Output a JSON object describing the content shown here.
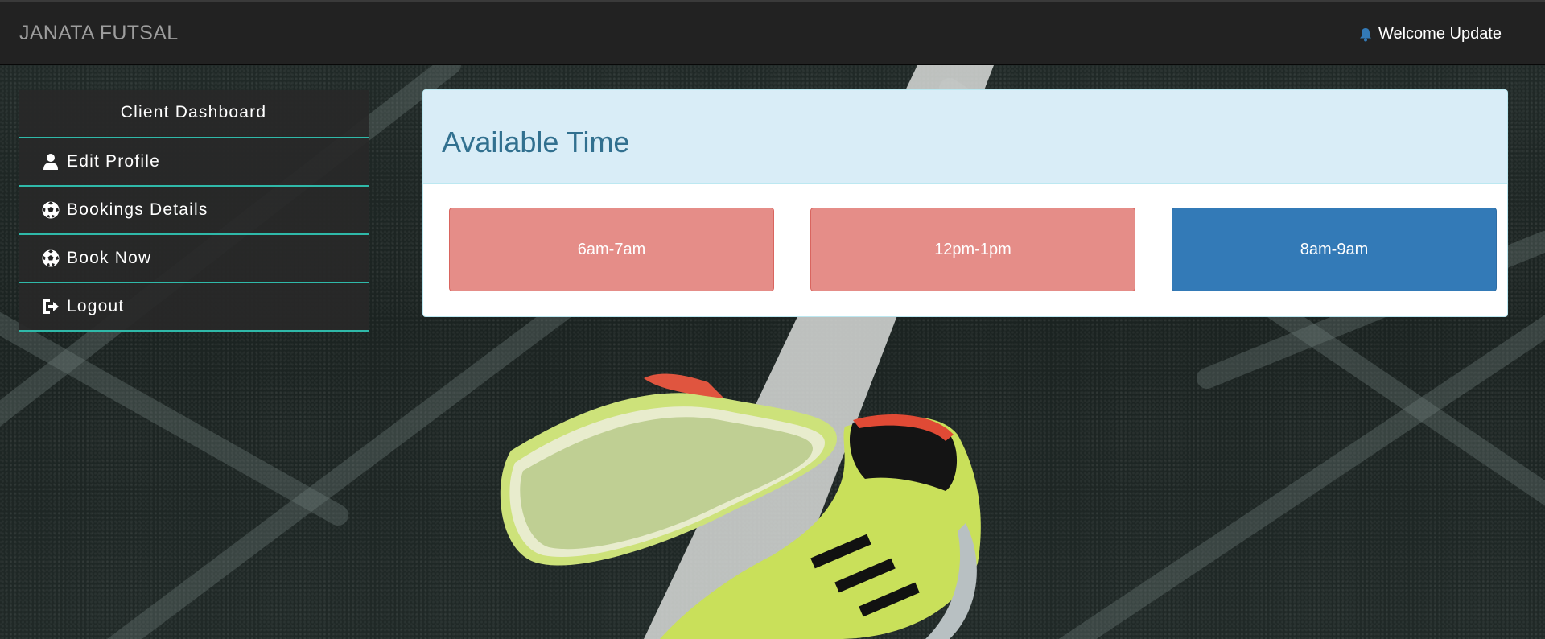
{
  "navbar": {
    "brand": "JANATA FUTSAL",
    "notification_icon": "bell-icon",
    "notification_label": "Welcome Update"
  },
  "sidebar": {
    "title": "Client Dashboard",
    "items": [
      {
        "label": "Edit Profile",
        "icon": "user-icon"
      },
      {
        "label": "Bookings Details",
        "icon": "soccer-ball-icon"
      },
      {
        "label": "Book Now",
        "icon": "soccer-ball-icon"
      },
      {
        "label": "Logout",
        "icon": "sign-out-icon"
      }
    ],
    "divider_color": "#2fb9a9"
  },
  "panel": {
    "title": "Available Time",
    "slots": [
      {
        "label": "6am-7am",
        "status": "booked",
        "color": "#e58d88"
      },
      {
        "label": "12pm-1pm",
        "status": "booked",
        "color": "#e58d88"
      },
      {
        "label": "8am-9am",
        "status": "available",
        "color": "#337ab7"
      }
    ]
  },
  "background": {
    "description_icon": "futsal-shoes-background-image"
  }
}
